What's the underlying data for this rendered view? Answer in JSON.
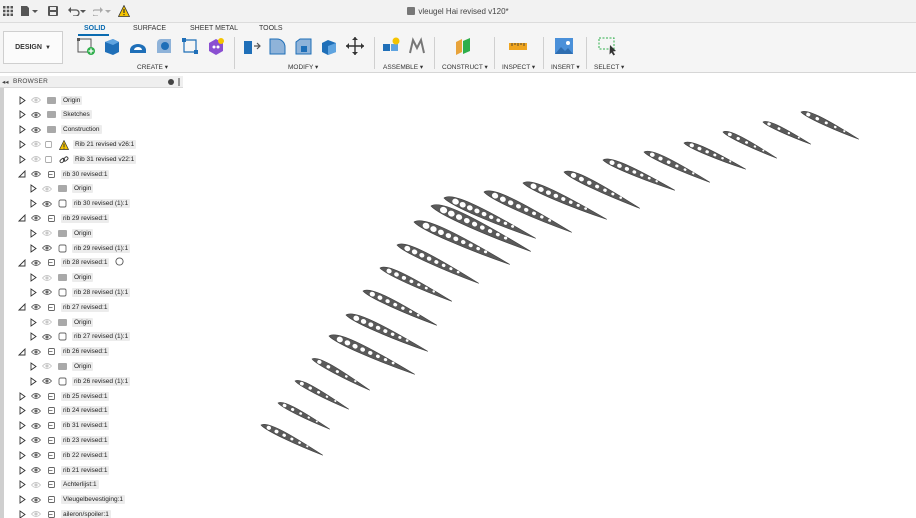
{
  "title": "vleugel Hai revised v120*",
  "mode_button": "DESIGN",
  "tabs": [
    "SOLID",
    "SURFACE",
    "SHEET METAL",
    "TOOLS"
  ],
  "groups": {
    "create": "CREATE",
    "modify": "MODIFY",
    "assemble": "ASSEMBLE",
    "construct": "CONSTRUCT",
    "inspect": "INSPECT",
    "insert": "INSERT",
    "select": "SELECT"
  },
  "browser": {
    "label": "BROWSER",
    "items": [
      {
        "label": "Origin",
        "depth": 0,
        "expanded": false,
        "icon": "folder",
        "visible": false
      },
      {
        "label": "Sketches",
        "depth": 0,
        "expanded": false,
        "icon": "folder",
        "visible": true
      },
      {
        "label": "Construction",
        "depth": 0,
        "expanded": false,
        "icon": "folder",
        "visible": true
      },
      {
        "label": "Rib 21 revised v26:1",
        "depth": 0,
        "expanded": false,
        "icon": "warning-component",
        "visible": false
      },
      {
        "label": "Rib 31 revised v22:1",
        "depth": 0,
        "expanded": false,
        "icon": "link-component",
        "visible": false
      },
      {
        "label": "rib 30 revised:1",
        "depth": 0,
        "expanded": true,
        "icon": "component",
        "visible": true
      },
      {
        "label": "Origin",
        "depth": 1,
        "expanded": false,
        "icon": "folder",
        "visible": false
      },
      {
        "label": "rib 30 revised (1):1",
        "depth": 1,
        "expanded": false,
        "icon": "body",
        "visible": true
      },
      {
        "label": "rib 29 revised:1",
        "depth": 0,
        "expanded": true,
        "icon": "component",
        "visible": true
      },
      {
        "label": "Origin",
        "depth": 1,
        "expanded": false,
        "icon": "folder",
        "visible": false
      },
      {
        "label": "rib 29 revised (1):1",
        "depth": 1,
        "expanded": false,
        "icon": "body",
        "visible": true
      },
      {
        "label": "rib 28 revised:1",
        "depth": 0,
        "expanded": true,
        "icon": "component",
        "visible": true,
        "radio": true
      },
      {
        "label": "Origin",
        "depth": 1,
        "expanded": false,
        "icon": "folder",
        "visible": false
      },
      {
        "label": "rib 28 revised (1):1",
        "depth": 1,
        "expanded": false,
        "icon": "body",
        "visible": true
      },
      {
        "label": "rib 27 revised:1",
        "depth": 0,
        "expanded": true,
        "icon": "component",
        "visible": true
      },
      {
        "label": "Origin",
        "depth": 1,
        "expanded": false,
        "icon": "folder",
        "visible": false
      },
      {
        "label": "rib 27 revised (1):1",
        "depth": 1,
        "expanded": false,
        "icon": "body",
        "visible": true
      },
      {
        "label": "rib 26 revised:1",
        "depth": 0,
        "expanded": true,
        "icon": "component",
        "visible": true
      },
      {
        "label": "Origin",
        "depth": 1,
        "expanded": false,
        "icon": "folder",
        "visible": false
      },
      {
        "label": "rib 26 revised (1):1",
        "depth": 1,
        "expanded": false,
        "icon": "body",
        "visible": true
      },
      {
        "label": "rib 25 revised:1",
        "depth": 0,
        "expanded": false,
        "icon": "component",
        "visible": true
      },
      {
        "label": "rib 24 revised:1",
        "depth": 0,
        "expanded": false,
        "icon": "component",
        "visible": true
      },
      {
        "label": "rib 31 revised:1",
        "depth": 0,
        "expanded": false,
        "icon": "component",
        "visible": true
      },
      {
        "label": "rib 23 revised:1",
        "depth": 0,
        "expanded": false,
        "icon": "component",
        "visible": true
      },
      {
        "label": "rib 22 revised:1",
        "depth": 0,
        "expanded": false,
        "icon": "component",
        "visible": true
      },
      {
        "label": "rib 21 revised:1",
        "depth": 0,
        "expanded": false,
        "icon": "component",
        "visible": true
      },
      {
        "label": "Achterlijst:1",
        "depth": 0,
        "expanded": false,
        "icon": "component",
        "visible": false
      },
      {
        "label": "Vleugelbevestiging:1",
        "depth": 0,
        "expanded": false,
        "icon": "component",
        "visible": true
      },
      {
        "label": "aileron/spoiler:1",
        "depth": 0,
        "expanded": false,
        "icon": "component",
        "visible": false
      }
    ]
  },
  "colors": {
    "accent": "#0a6bb0",
    "rib": "#5a5a5a",
    "warning": "#f5c400"
  }
}
